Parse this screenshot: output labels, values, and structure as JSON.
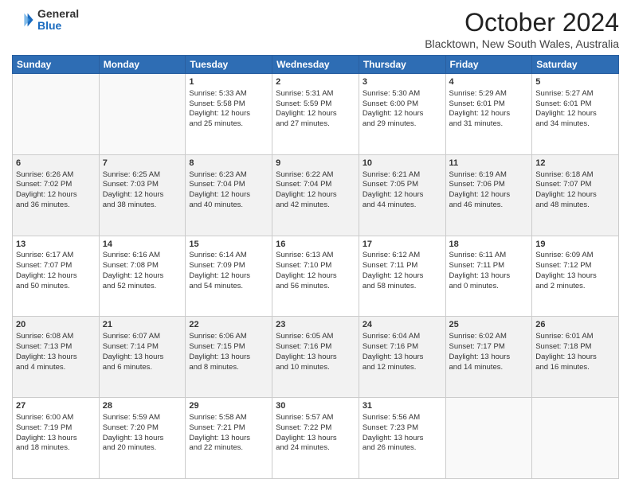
{
  "logo": {
    "general": "General",
    "blue": "Blue"
  },
  "header": {
    "month": "October 2024",
    "location": "Blacktown, New South Wales, Australia"
  },
  "weekdays": [
    "Sunday",
    "Monday",
    "Tuesday",
    "Wednesday",
    "Thursday",
    "Friday",
    "Saturday"
  ],
  "weeks": [
    [
      {
        "day": "",
        "text": ""
      },
      {
        "day": "",
        "text": ""
      },
      {
        "day": "1",
        "text": "Sunrise: 5:33 AM\nSunset: 5:58 PM\nDaylight: 12 hours\nand 25 minutes."
      },
      {
        "day": "2",
        "text": "Sunrise: 5:31 AM\nSunset: 5:59 PM\nDaylight: 12 hours\nand 27 minutes."
      },
      {
        "day": "3",
        "text": "Sunrise: 5:30 AM\nSunset: 6:00 PM\nDaylight: 12 hours\nand 29 minutes."
      },
      {
        "day": "4",
        "text": "Sunrise: 5:29 AM\nSunset: 6:01 PM\nDaylight: 12 hours\nand 31 minutes."
      },
      {
        "day": "5",
        "text": "Sunrise: 5:27 AM\nSunset: 6:01 PM\nDaylight: 12 hours\nand 34 minutes."
      }
    ],
    [
      {
        "day": "6",
        "text": "Sunrise: 6:26 AM\nSunset: 7:02 PM\nDaylight: 12 hours\nand 36 minutes."
      },
      {
        "day": "7",
        "text": "Sunrise: 6:25 AM\nSunset: 7:03 PM\nDaylight: 12 hours\nand 38 minutes."
      },
      {
        "day": "8",
        "text": "Sunrise: 6:23 AM\nSunset: 7:04 PM\nDaylight: 12 hours\nand 40 minutes."
      },
      {
        "day": "9",
        "text": "Sunrise: 6:22 AM\nSunset: 7:04 PM\nDaylight: 12 hours\nand 42 minutes."
      },
      {
        "day": "10",
        "text": "Sunrise: 6:21 AM\nSunset: 7:05 PM\nDaylight: 12 hours\nand 44 minutes."
      },
      {
        "day": "11",
        "text": "Sunrise: 6:19 AM\nSunset: 7:06 PM\nDaylight: 12 hours\nand 46 minutes."
      },
      {
        "day": "12",
        "text": "Sunrise: 6:18 AM\nSunset: 7:07 PM\nDaylight: 12 hours\nand 48 minutes."
      }
    ],
    [
      {
        "day": "13",
        "text": "Sunrise: 6:17 AM\nSunset: 7:07 PM\nDaylight: 12 hours\nand 50 minutes."
      },
      {
        "day": "14",
        "text": "Sunrise: 6:16 AM\nSunset: 7:08 PM\nDaylight: 12 hours\nand 52 minutes."
      },
      {
        "day": "15",
        "text": "Sunrise: 6:14 AM\nSunset: 7:09 PM\nDaylight: 12 hours\nand 54 minutes."
      },
      {
        "day": "16",
        "text": "Sunrise: 6:13 AM\nSunset: 7:10 PM\nDaylight: 12 hours\nand 56 minutes."
      },
      {
        "day": "17",
        "text": "Sunrise: 6:12 AM\nSunset: 7:11 PM\nDaylight: 12 hours\nand 58 minutes."
      },
      {
        "day": "18",
        "text": "Sunrise: 6:11 AM\nSunset: 7:11 PM\nDaylight: 13 hours\nand 0 minutes."
      },
      {
        "day": "19",
        "text": "Sunrise: 6:09 AM\nSunset: 7:12 PM\nDaylight: 13 hours\nand 2 minutes."
      }
    ],
    [
      {
        "day": "20",
        "text": "Sunrise: 6:08 AM\nSunset: 7:13 PM\nDaylight: 13 hours\nand 4 minutes."
      },
      {
        "day": "21",
        "text": "Sunrise: 6:07 AM\nSunset: 7:14 PM\nDaylight: 13 hours\nand 6 minutes."
      },
      {
        "day": "22",
        "text": "Sunrise: 6:06 AM\nSunset: 7:15 PM\nDaylight: 13 hours\nand 8 minutes."
      },
      {
        "day": "23",
        "text": "Sunrise: 6:05 AM\nSunset: 7:16 PM\nDaylight: 13 hours\nand 10 minutes."
      },
      {
        "day": "24",
        "text": "Sunrise: 6:04 AM\nSunset: 7:16 PM\nDaylight: 13 hours\nand 12 minutes."
      },
      {
        "day": "25",
        "text": "Sunrise: 6:02 AM\nSunset: 7:17 PM\nDaylight: 13 hours\nand 14 minutes."
      },
      {
        "day": "26",
        "text": "Sunrise: 6:01 AM\nSunset: 7:18 PM\nDaylight: 13 hours\nand 16 minutes."
      }
    ],
    [
      {
        "day": "27",
        "text": "Sunrise: 6:00 AM\nSunset: 7:19 PM\nDaylight: 13 hours\nand 18 minutes."
      },
      {
        "day": "28",
        "text": "Sunrise: 5:59 AM\nSunset: 7:20 PM\nDaylight: 13 hours\nand 20 minutes."
      },
      {
        "day": "29",
        "text": "Sunrise: 5:58 AM\nSunset: 7:21 PM\nDaylight: 13 hours\nand 22 minutes."
      },
      {
        "day": "30",
        "text": "Sunrise: 5:57 AM\nSunset: 7:22 PM\nDaylight: 13 hours\nand 24 minutes."
      },
      {
        "day": "31",
        "text": "Sunrise: 5:56 AM\nSunset: 7:23 PM\nDaylight: 13 hours\nand 26 minutes."
      },
      {
        "day": "",
        "text": ""
      },
      {
        "day": "",
        "text": ""
      }
    ]
  ],
  "row_styles": [
    "row-white",
    "row-shaded",
    "row-white",
    "row-shaded",
    "row-white"
  ]
}
